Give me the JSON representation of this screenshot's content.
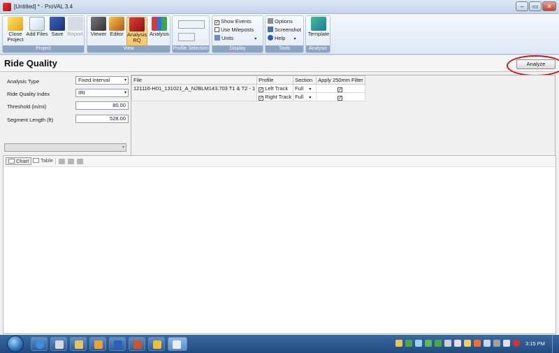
{
  "window": {
    "title": "[Untitled] * - ProVAL 3.4",
    "buttons": {
      "minimize": "–",
      "restore": "▭",
      "close": "✕"
    }
  },
  "ribbon": {
    "project": {
      "label": "Project",
      "close_project": "Close Project",
      "add_files": "Add Files",
      "save": "Save",
      "report": "Report"
    },
    "view": {
      "label": "View",
      "viewer": "Viewer",
      "editor": "Editor",
      "analysis_rq": "Analysis RQ",
      "analysis": "Analysis"
    },
    "profile_selection": {
      "label": "Profile Selection"
    },
    "display": {
      "label": "Display",
      "show_events": "Show Events",
      "show_events_checked": "✓",
      "use_mileposts": "Use Mileposts",
      "units": "Units"
    },
    "tools": {
      "label": "Tools",
      "options": "Options",
      "screenshot": "Screenshot",
      "help": "Help"
    },
    "analysis_group": {
      "label": "Analysis",
      "template": "Template"
    }
  },
  "page": {
    "title": "Ride Quality",
    "analyze_button": "Analyze"
  },
  "params": {
    "analysis_type_label": "Analysis Type",
    "analysis_type_value": "Fixed Interval",
    "ride_quality_index_label": "Ride Quality Index",
    "ride_quality_index_value": "IRI",
    "threshold_label": "Threshold (in/mi)",
    "threshold_value": "80.00",
    "segment_length_label": "Segment Length (ft)",
    "segment_length_value": "528.00"
  },
  "file_table": {
    "headers": [
      "File",
      "Profile",
      "Section",
      "Apply 250mm Filter"
    ],
    "file_name": "121116-H01_131021_A_N2BLM143.703 T1 & T2 - 1",
    "rows": [
      {
        "profile": "Left Track",
        "section": "Full",
        "filter": "✓",
        "profile_check": "✓"
      },
      {
        "profile": "Right Track",
        "section": "Full",
        "filter": "✓",
        "profile_check": "✓"
      }
    ]
  },
  "chart_tabs": {
    "chart": "Chart",
    "table": "Table"
  },
  "taskbar": {
    "clock": "3:15 PM"
  },
  "colors": {
    "highlight": "#c8141c",
    "ribbon_label": "#8ca3c2",
    "taskbar": "#2a5a91"
  }
}
